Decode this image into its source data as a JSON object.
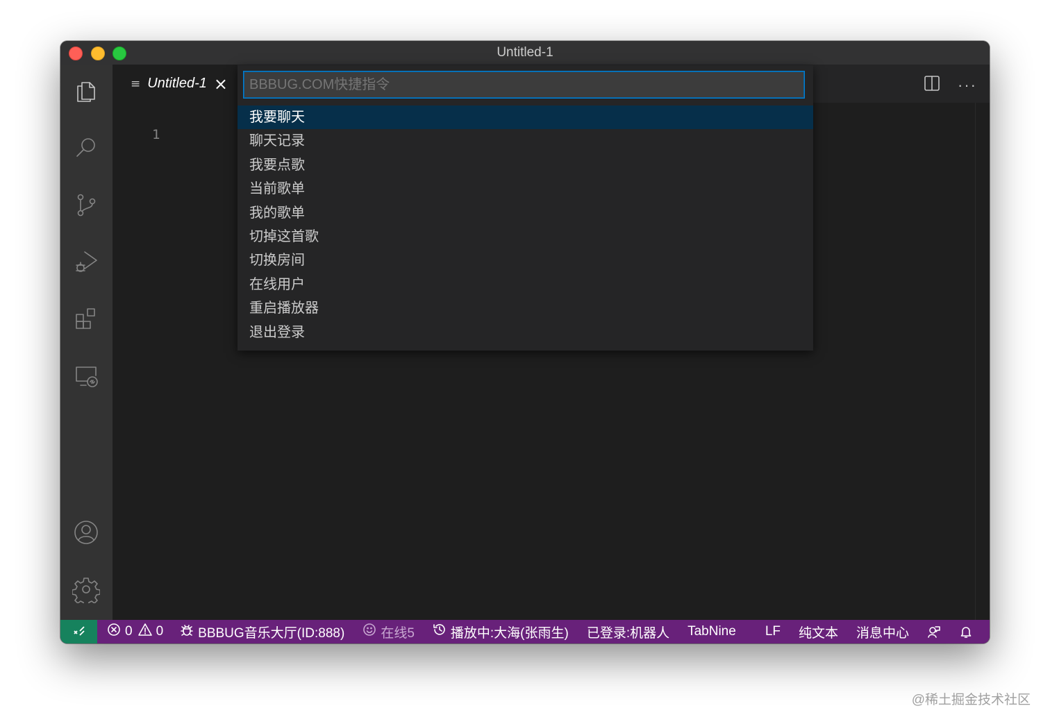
{
  "window": {
    "title": "Untitled-1"
  },
  "activity_bar": {
    "items": [
      "explorer-icon",
      "search-icon",
      "source-control-icon",
      "run-debug-icon",
      "extensions-icon",
      "remote-explorer-icon"
    ],
    "bottom": [
      "accounts-icon",
      "settings-gear-icon"
    ]
  },
  "tab": {
    "label": "Untitled-1",
    "close_glyph": "×"
  },
  "editor": {
    "line_numbers": [
      "1"
    ]
  },
  "editor_actions": {
    "more_glyph": "···"
  },
  "quick_pick": {
    "placeholder": "BBBUG.COM快捷指令",
    "items": [
      "我要聊天",
      "聊天记录",
      "我要点歌",
      "当前歌单",
      "我的歌单",
      "切掉这首歌",
      "切换房间",
      "在线用户",
      "重启播放器",
      "退出登录"
    ],
    "selected_index": 0
  },
  "status_bar": {
    "errors": "0",
    "warnings": "0",
    "room": "BBBUG音乐大厅(ID:888)",
    "online": "在线5",
    "playing": "播放中:大海(张雨生)",
    "login": "已登录:机器人",
    "tabnine": "TabNine",
    "eol": "LF",
    "language": "纯文本",
    "messages": "消息中心"
  },
  "watermark": "@稀土掘金技术社区",
  "colors": {
    "accent": "#007fd4",
    "status_bar": "#68217a",
    "remote": "#16825d",
    "selection": "#062f4a"
  }
}
